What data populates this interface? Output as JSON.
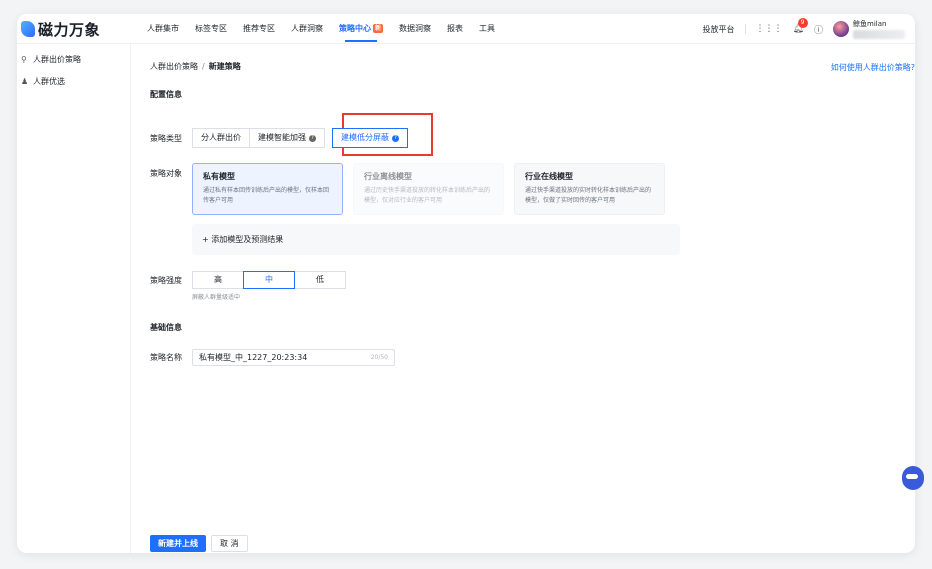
{
  "app": {
    "logo_text": "磁力万象"
  },
  "nav": {
    "items": [
      {
        "label": "人群集市"
      },
      {
        "label": "标签专区"
      },
      {
        "label": "推荐专区"
      },
      {
        "label": "人群洞察"
      },
      {
        "label": "策略中心",
        "badge": "新",
        "active": true
      },
      {
        "label": "数据洞察"
      },
      {
        "label": "报表"
      },
      {
        "label": "工具"
      }
    ]
  },
  "header_right": {
    "platform_label": "投放平台",
    "notification_count": "9",
    "user_name": "鲸鱼milan"
  },
  "sidebar": {
    "items": [
      {
        "label": "人群出价策略",
        "icon": "strategy-icon"
      },
      {
        "label": "人群优选",
        "icon": "people-icon"
      }
    ]
  },
  "breadcrumb": {
    "parent": "人群出价策略",
    "separator": "/",
    "current": "新建策略"
  },
  "help_link": "如何使用人群出价策略?",
  "config": {
    "section_title": "配置信息",
    "type_label": "策略类型",
    "types": [
      {
        "label": "分人群出价"
      },
      {
        "label": "建模智能加强"
      },
      {
        "label": "建模低分屏蔽",
        "selected": true
      }
    ],
    "target_label": "策略对象",
    "models": [
      {
        "title": "私有模型",
        "desc": "通过私有样本回传训练后产出的模型，仅样本回传客户可用",
        "state": "selected"
      },
      {
        "title": "行业离线模型",
        "desc": "通过历史快手渠道投放的转化样本训练后产出的模型，仅对应行业的客户可用",
        "state": "disabled"
      },
      {
        "title": "行业在线模型",
        "desc": "通过快手渠道投放的实时转化样本训练后产出的模型，仅做了实时回传的客户可用",
        "state": "normal"
      }
    ],
    "add_model_label": "+ 添加模型及预测结果",
    "strength_label": "策略强度",
    "strengths": [
      {
        "label": "高"
      },
      {
        "label": "中",
        "selected": true
      },
      {
        "label": "低"
      }
    ],
    "strength_hint": "屏蔽人群量级适中"
  },
  "basic": {
    "section_title": "基础信息",
    "name_label": "策略名称",
    "name_value": "私有模型_中_1227_20:23:34",
    "name_count": "20/50"
  },
  "footer": {
    "submit_label": "新建并上线",
    "cancel_label": "取 消"
  }
}
